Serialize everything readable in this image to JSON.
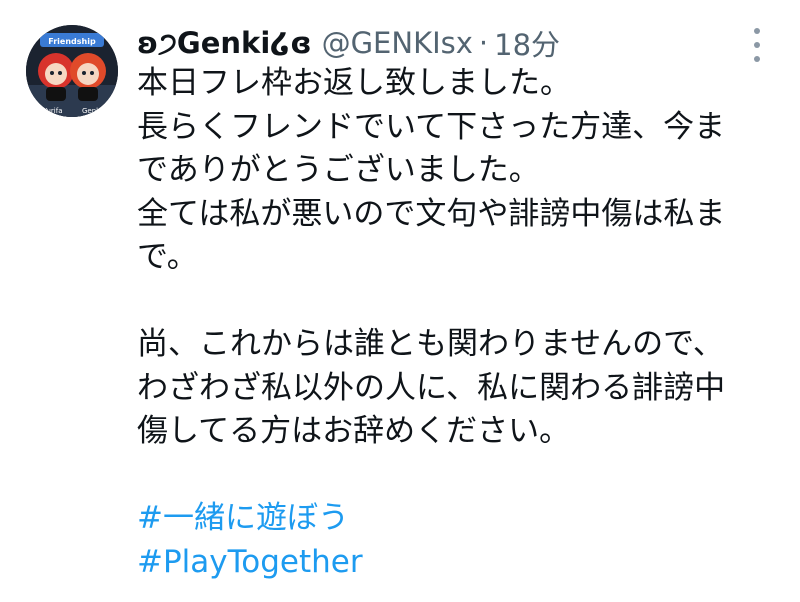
{
  "tweet": {
    "display_name": "ʚ੭Genki໒ɞ",
    "handle": "@GENKIsx",
    "separator": "·",
    "time": "18分",
    "avatar": {
      "caption_left": "Yurifa",
      "caption_right": "Genki",
      "logo": "Friendship"
    },
    "menu_icon": "more-vertical-icon",
    "paragraph1": [
      "本日フレ枠お返し致しました。",
      "長らくフレンドでいて下さった方達、今ま",
      "でありがとうございました。",
      "全ては私が悪いので文句や誹謗中傷は私ま",
      "で。"
    ],
    "paragraph2": [
      "尚、これからは誰とも関わりませんので、",
      "わざわざ私以外の人に、私に関わる誹謗中",
      "傷してる方はお辞めください。"
    ],
    "hashtags": [
      "#一緒に遊ぼう",
      "#PlayTogether"
    ]
  },
  "colors": {
    "text": "#0f1419",
    "secondary": "#536471",
    "hashtag": "#1d9bf0"
  }
}
